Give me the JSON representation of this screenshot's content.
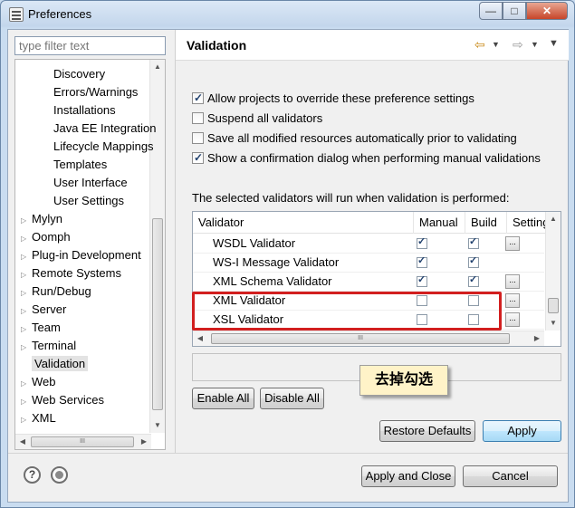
{
  "window": {
    "title": "Preferences",
    "minimize_glyph": "—",
    "maximize_glyph": "□",
    "close_glyph": "✕"
  },
  "filter": {
    "placeholder": "type filter text"
  },
  "tree": {
    "items": [
      {
        "label": "Discovery",
        "indent": 2,
        "arrow": false
      },
      {
        "label": "Errors/Warnings",
        "indent": 2,
        "arrow": false
      },
      {
        "label": "Installations",
        "indent": 2,
        "arrow": false
      },
      {
        "label": "Java EE Integration",
        "indent": 2,
        "arrow": false
      },
      {
        "label": "Lifecycle Mappings",
        "indent": 2,
        "arrow": false
      },
      {
        "label": "Templates",
        "indent": 2,
        "arrow": false
      },
      {
        "label": "User Interface",
        "indent": 2,
        "arrow": false
      },
      {
        "label": "User Settings",
        "indent": 2,
        "arrow": false
      },
      {
        "label": "Mylyn",
        "indent": 1,
        "arrow": true
      },
      {
        "label": "Oomph",
        "indent": 1,
        "arrow": true
      },
      {
        "label": "Plug-in Development",
        "indent": 1,
        "arrow": true
      },
      {
        "label": "Remote Systems",
        "indent": 1,
        "arrow": true
      },
      {
        "label": "Run/Debug",
        "indent": 1,
        "arrow": true
      },
      {
        "label": "Server",
        "indent": 1,
        "arrow": true
      },
      {
        "label": "Team",
        "indent": 1,
        "arrow": true
      },
      {
        "label": "Terminal",
        "indent": 1,
        "arrow": true
      },
      {
        "label": "Validation",
        "indent": 1,
        "arrow": false,
        "selected": true
      },
      {
        "label": "Web",
        "indent": 1,
        "arrow": true
      },
      {
        "label": "Web Services",
        "indent": 1,
        "arrow": true
      },
      {
        "label": "XML",
        "indent": 1,
        "arrow": true
      }
    ],
    "scroll_glyph": "III"
  },
  "page": {
    "title": "Validation",
    "options": [
      {
        "label": "Allow projects to override these preference settings",
        "checked": true
      },
      {
        "label": "Suspend all validators",
        "checked": false
      },
      {
        "label": "Save all modified resources automatically prior to validating",
        "checked": false
      },
      {
        "label": "Show a confirmation dialog when performing manual validations",
        "checked": true
      }
    ],
    "caption": "The selected validators will run when validation is performed:",
    "columns": [
      "Validator",
      "Manual",
      "Build",
      "Settings"
    ],
    "rows": [
      {
        "name": "WSDL Validator",
        "manual": true,
        "build": true,
        "settings": true
      },
      {
        "name": "WS-I Message Validator",
        "manual": true,
        "build": true,
        "settings": false
      },
      {
        "name": "XML Schema Validator",
        "manual": true,
        "build": true,
        "settings": true
      },
      {
        "name": "XML Validator",
        "manual": false,
        "build": false,
        "settings": true
      },
      {
        "name": "XSL Validator",
        "manual": false,
        "build": false,
        "settings": true
      }
    ],
    "settings_glyph": "...",
    "table_scroll_glyph": "III",
    "enable_all": "Enable All",
    "disable_all": "Disable All",
    "restore_defaults": "Restore Defaults",
    "apply": "Apply"
  },
  "annotation": {
    "text": "去掉勾选",
    "color": "#d21f1f"
  },
  "footer": {
    "apply_and_close": "Apply and Close",
    "cancel": "Cancel",
    "help_glyph": "?"
  },
  "icons": [
    "back-arrow-icon",
    "forward-arrow-icon",
    "dropdown-chevron-icon",
    "view-menu-icon",
    "help-icon",
    "record-icon"
  ]
}
